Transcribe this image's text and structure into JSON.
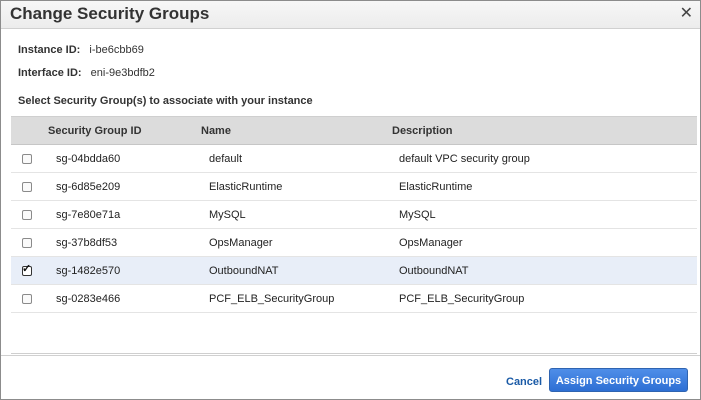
{
  "dialog": {
    "title": "Change Security Groups",
    "close_label": "✕"
  },
  "info": {
    "instance_label": "Instance ID:",
    "instance_value": "i-be6cbb69",
    "interface_label": "Interface ID:",
    "interface_value": "eni-9e3bdfb2"
  },
  "prompt": "Select Security Group(s) to associate with your instance",
  "table": {
    "headers": {
      "id": "Security Group ID",
      "name": "Name",
      "description": "Description"
    },
    "rows": [
      {
        "id": "sg-04bdda60",
        "name": "default",
        "description": "default VPC security group",
        "checked": false
      },
      {
        "id": "sg-6d85e209",
        "name": "ElasticRuntime",
        "description": "ElasticRuntime",
        "checked": false
      },
      {
        "id": "sg-7e80e71a",
        "name": "MySQL",
        "description": "MySQL",
        "checked": false
      },
      {
        "id": "sg-37b8df53",
        "name": "OpsManager",
        "description": "OpsManager",
        "checked": false
      },
      {
        "id": "sg-1482e570",
        "name": "OutboundNAT",
        "description": "OutboundNAT",
        "checked": true
      },
      {
        "id": "sg-0283e466",
        "name": "PCF_ELB_SecurityGroup",
        "description": "PCF_ELB_SecurityGroup",
        "checked": false
      }
    ]
  },
  "footer": {
    "cancel_label": "Cancel",
    "assign_label": "Assign Security Groups"
  },
  "colors": {
    "accent": "#2d6fd4",
    "link": "#1a5aa6",
    "selected_row": "#e8eef8"
  },
  "icons": {
    "close": "close-icon",
    "check": "checkmark-icon"
  }
}
